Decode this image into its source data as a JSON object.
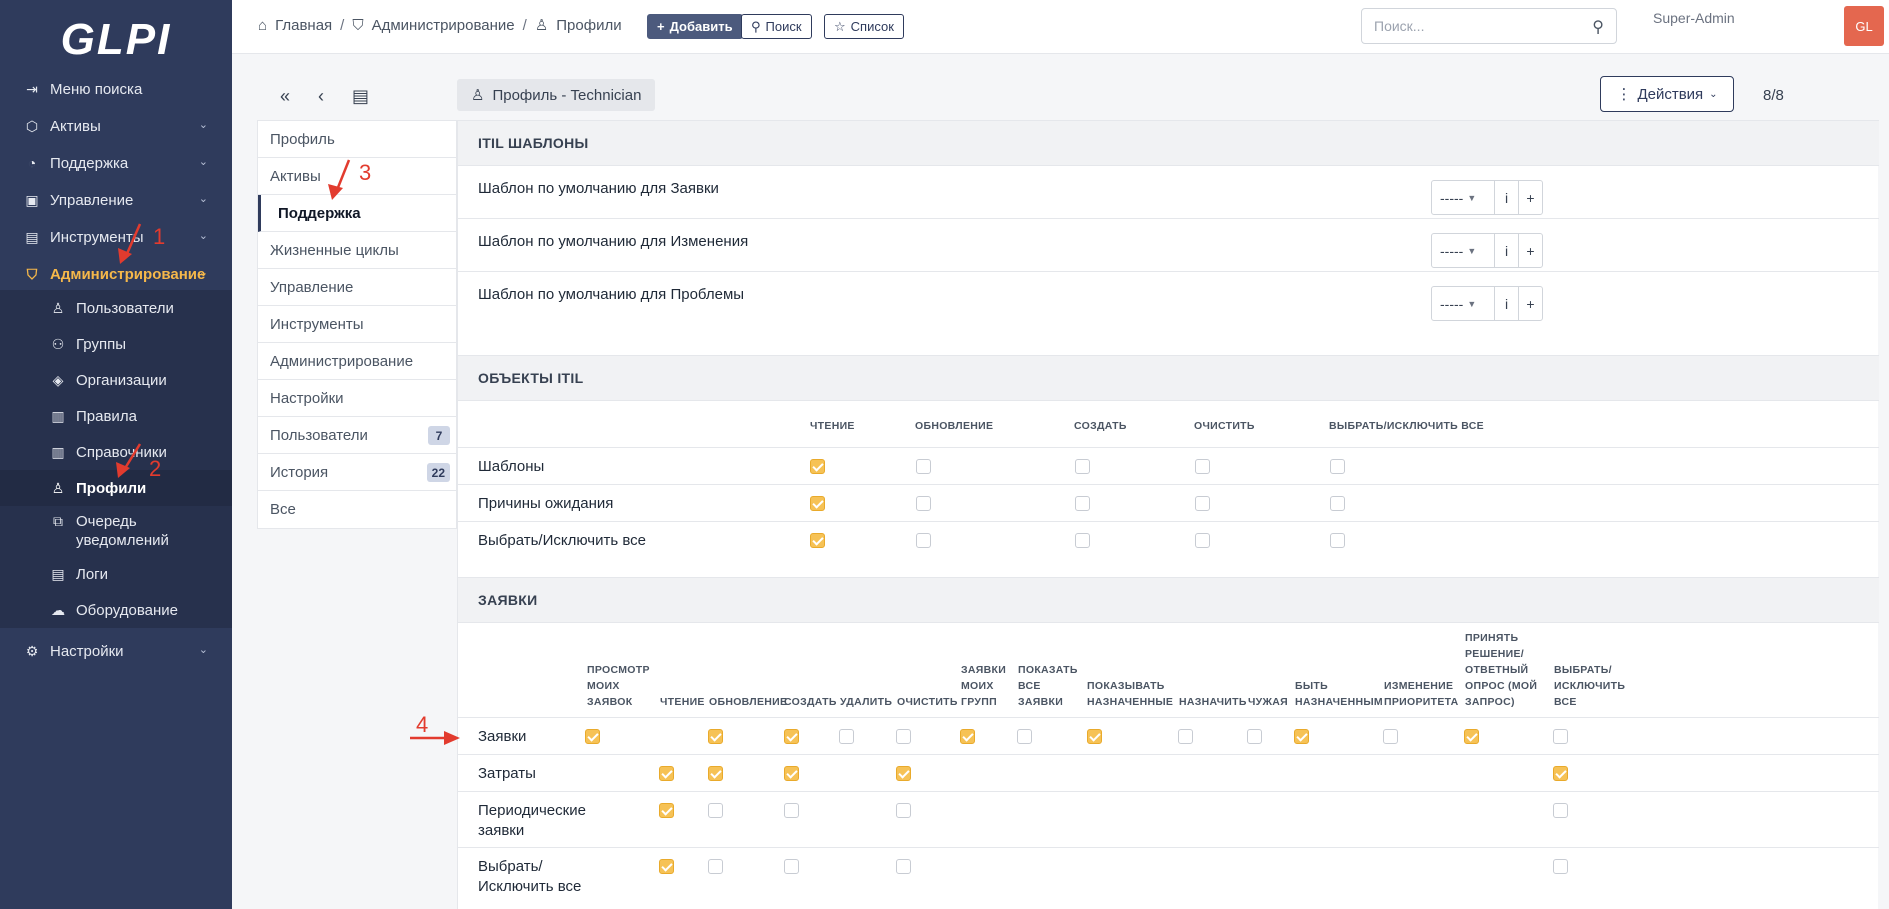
{
  "sidebar": {
    "logo": "GLPI",
    "items": [
      {
        "label": "Меню поиска",
        "icon": "search-menu-icon"
      },
      {
        "label": "Активы",
        "icon": "cube-icon"
      },
      {
        "label": "Поддержка",
        "icon": "headset-icon"
      },
      {
        "label": "Управление",
        "icon": "wallet-icon"
      },
      {
        "label": "Инструменты",
        "icon": "briefcase-icon"
      },
      {
        "label": "Администрирование",
        "icon": "shield-icon"
      },
      {
        "label": "Настройки",
        "icon": "gear-icon"
      }
    ],
    "sub_items": [
      {
        "label": "Пользователи"
      },
      {
        "label": "Группы"
      },
      {
        "label": "Организации"
      },
      {
        "label": "Правила"
      },
      {
        "label": "Справочники"
      },
      {
        "label": "Профили"
      },
      {
        "label": "Очередь уведомлений"
      },
      {
        "label": "Логи"
      },
      {
        "label": "Оборудование"
      }
    ]
  },
  "topbar": {
    "breadcrumb": [
      "Главная",
      "Администрирование",
      "Профили"
    ],
    "add_label": "Добавить",
    "search_label": "Поиск",
    "list_label": "Список",
    "search_placeholder": "Поиск...",
    "user_name": "Super-Admin",
    "avatar_initials": "GL"
  },
  "toolbar": {
    "profile_title": "Профиль - Technician",
    "actions_label": "Действия",
    "pager": "8/8"
  },
  "tabs": [
    {
      "label": "Профиль"
    },
    {
      "label": "Активы"
    },
    {
      "label": "Поддержка"
    },
    {
      "label": "Жизненные циклы"
    },
    {
      "label": "Управление"
    },
    {
      "label": "Инструменты"
    },
    {
      "label": "Администрирование"
    },
    {
      "label": "Настройки"
    },
    {
      "label": "Пользователи",
      "badge": "7"
    },
    {
      "label": "История",
      "badge": "22"
    },
    {
      "label": "Все"
    }
  ],
  "itil_templates": {
    "title": "ITIL ШАБЛОНЫ",
    "rows": [
      {
        "label": "Шаблон по умолчанию для Заявки",
        "value": "-----"
      },
      {
        "label": "Шаблон по умолчанию для Изменения",
        "value": "-----"
      },
      {
        "label": "Шаблон по умолчанию для Проблемы",
        "value": "-----"
      }
    ],
    "info_label": "i",
    "plus_label": "+"
  },
  "itil_objects": {
    "title": "ОБЪЕКТЫ ITIL",
    "columns": [
      "ЧТЕНИЕ",
      "ОБНОВЛЕНИЕ",
      "СОЗДАТЬ",
      "ОЧИСТИТЬ",
      "ВЫБРАТЬ/ИСКЛЮЧИТЬ ВСЕ"
    ],
    "rows": [
      {
        "label": "Шаблоны",
        "checks": [
          true,
          false,
          false,
          false,
          false
        ]
      },
      {
        "label": "Причины ожидания",
        "checks": [
          true,
          false,
          false,
          false,
          false
        ]
      },
      {
        "label": "Выбрать/Исключить все",
        "checks": [
          true,
          false,
          false,
          false,
          false
        ]
      }
    ]
  },
  "tickets": {
    "title": "ЗАЯВКИ",
    "columns": [
      "ПРОСМОТР МОИХ ЗАЯВОК",
      "ЧТЕНИЕ",
      "ОБНОВЛЕНИЕ",
      "СОЗДАТЬ",
      "УДАЛИТЬ",
      "ОЧИСТИТЬ",
      "ЗАЯВКИ МОИХ ГРУПП",
      "ПОКАЗАТЬ ВСЕ ЗАЯВКИ",
      "ПОКАЗЫВАТЬ НАЗНАЧЕННЫЕ",
      "НАЗНАЧИТЬ",
      "ЧУЖАЯ",
      "БЫТЬ НАЗНАЧЕННЫМ",
      "ИЗМЕНЕНИЕ ПРИОРИТЕТА",
      "ПРИНЯТЬ РЕШЕНИЕ/ ОТВЕТНЫЙ ОПРОС (МОЙ ЗАПРОС)",
      "ВЫБРАТЬ/ ИСКЛЮЧИТЬ ВСЕ"
    ],
    "rows": [
      {
        "label": "Заявки",
        "checks": [
          true,
          null,
          true,
          true,
          false,
          false,
          true,
          false,
          true,
          false,
          false,
          true,
          false,
          true,
          false
        ]
      },
      {
        "label": "Затраты",
        "checks": [
          null,
          true,
          true,
          true,
          null,
          true,
          null,
          null,
          null,
          null,
          null,
          null,
          null,
          null,
          true
        ]
      },
      {
        "label": "Периодические заявки",
        "checks": [
          null,
          true,
          false,
          false,
          null,
          false,
          null,
          null,
          null,
          null,
          null,
          null,
          null,
          null,
          false
        ]
      },
      {
        "label": "Выбрать/ Исключить все",
        "checks": [
          null,
          true,
          false,
          false,
          null,
          false,
          null,
          null,
          null,
          null,
          null,
          null,
          null,
          null,
          false
        ]
      }
    ]
  },
  "annotations": [
    "1",
    "2",
    "3",
    "4"
  ]
}
